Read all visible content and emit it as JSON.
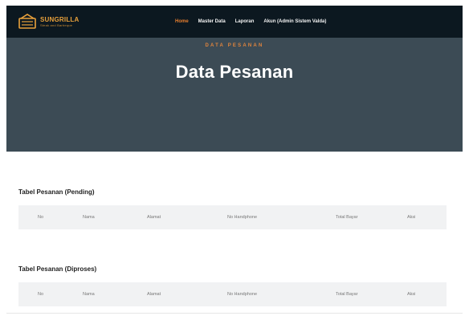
{
  "brand": {
    "name": "SUNGRILLA",
    "tagline": "Steak and Barbeque"
  },
  "nav": {
    "items": [
      {
        "label": "Home",
        "active": true
      },
      {
        "label": "Master Data",
        "active": false
      },
      {
        "label": "Laporan",
        "active": false
      },
      {
        "label": "Akun (Admin Sistem Valda)",
        "active": false
      }
    ]
  },
  "hero": {
    "eyebrow": "DATA PESANAN",
    "title": "Data Pesanan"
  },
  "sections": [
    {
      "title": "Tabel Pesanan (Pending)",
      "columns": [
        "No",
        "Nama",
        "Alamat",
        "No Handphone",
        "Total Bayar",
        "Aksi"
      ]
    },
    {
      "title": "Tabel Pesanan (Diproses)",
      "columns": [
        "No",
        "Nama",
        "Alamat",
        "No Handphone",
        "Total Bayar",
        "Aksi"
      ]
    }
  ],
  "colors": {
    "navbar": "#0c1820",
    "hero": "#3c4b55",
    "accent": "#e97f2e",
    "brand": "#e9a13b",
    "table_header": "#f1f2f3"
  }
}
